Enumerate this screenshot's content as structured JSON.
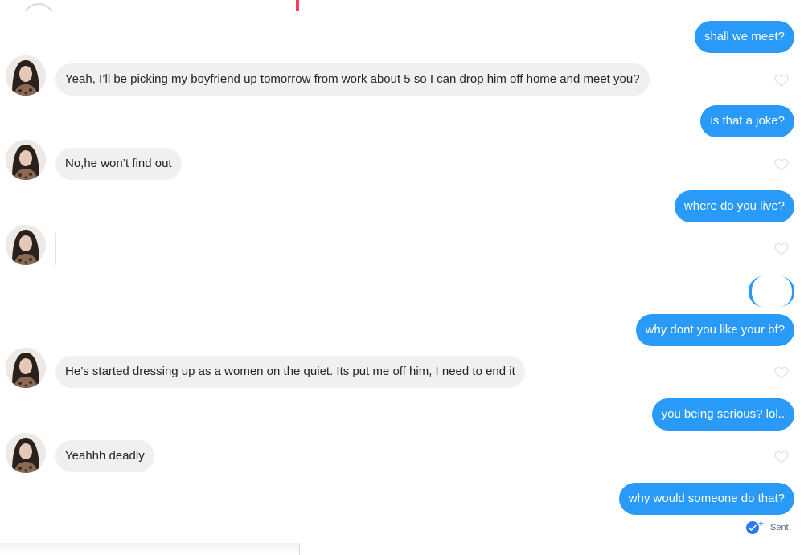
{
  "messages": [
    {
      "side": "out",
      "text": "shall we meet?"
    },
    {
      "side": "in",
      "text": "Yeah, I’ll be picking my boyfriend up tomorrow from work about 5 so I can drop him off home and meet you?"
    },
    {
      "side": "out",
      "text": "is that a joke?"
    },
    {
      "side": "in",
      "text": "No,he won’t find out"
    },
    {
      "side": "out",
      "text": "where do you live?"
    },
    {
      "side": "in",
      "text": ""
    },
    {
      "side": "out",
      "text": ""
    },
    {
      "side": "out",
      "text": "why dont you like your bf?"
    },
    {
      "side": "in",
      "text": "He’s started dressing up as a women on the quiet. Its put me off him, I need to end it"
    },
    {
      "side": "out",
      "text": "you being serious? lol.."
    },
    {
      "side": "in",
      "text": "Yeahhh deadly"
    },
    {
      "side": "out",
      "text": "why would someone do that?"
    }
  ],
  "status": {
    "label": "Sent",
    "icon": "double-check-icon"
  },
  "colors": {
    "outgoing": "#2a9af8",
    "incoming": "#f0f0f0",
    "accent": "#fd3a5a"
  }
}
